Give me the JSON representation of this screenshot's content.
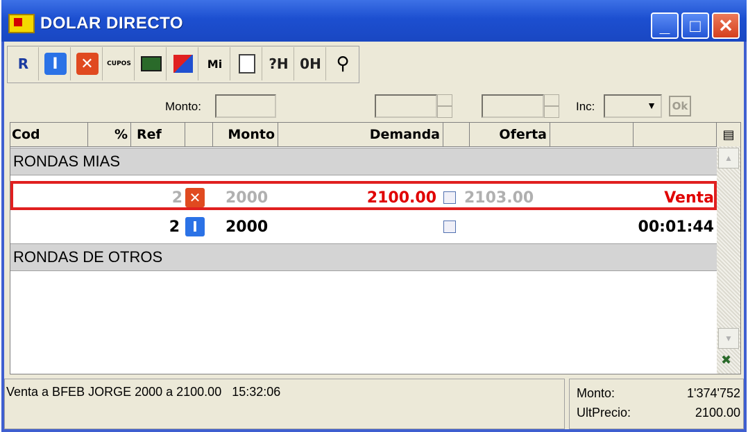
{
  "window": {
    "title": "DOLAR DIRECTO",
    "minimize": "_",
    "maximize": "□",
    "close": "✕"
  },
  "toolbar": {
    "buttons": [
      {
        "label": "R",
        "icon": "new-round-icon"
      },
      {
        "label": "I",
        "icon": "info-icon"
      },
      {
        "label": "✕",
        "icon": "delete-icon"
      },
      {
        "label": "CUPOS",
        "icon": "cupos-icon"
      },
      {
        "label": "",
        "icon": "windows-icon"
      },
      {
        "label": "",
        "icon": "chart-icon"
      },
      {
        "label": "Mi",
        "icon": "mi-percent-icon"
      },
      {
        "label": "",
        "icon": "notes-icon"
      },
      {
        "label": "?H",
        "icon": "query-h-icon"
      },
      {
        "label": "0H",
        "icon": "zero-h-icon"
      },
      {
        "label": "",
        "icon": "wrench-icon"
      }
    ]
  },
  "params": {
    "monto_label": "Monto:",
    "inc_label": "Inc:",
    "ok_label": "Ok"
  },
  "columns": {
    "cod": "Cod",
    "pct": "%",
    "ref": "Ref",
    "monto": "Monto",
    "demanda": "Demanda",
    "oferta": "Oferta"
  },
  "groups": {
    "mias": "RONDAS MIAS",
    "otros": "RONDAS DE OTROS"
  },
  "rows": [
    {
      "ref": "2",
      "monto": "2000",
      "demanda": "2100.00",
      "oferta": "2103.00",
      "status": "Venta",
      "icon": "cancel-icon"
    },
    {
      "ref": "2",
      "monto": "2000",
      "demanda": "",
      "oferta": "",
      "status": "00:01:44",
      "icon": "info-icon"
    }
  ],
  "status": {
    "message": "Venta a BFEB JORGE 2000 a 2100.00   15:32:06",
    "monto_label": "Monto:",
    "monto_value": "1'374'752",
    "ultprecio_label": "UltPrecio:",
    "ultprecio_value": "2100.00"
  },
  "colors": {
    "title_blue": "#1c4fd0",
    "highlight_red": "#e02020",
    "venta_red": "#e00000",
    "info_blue": "#2b72e6",
    "cancel_red": "#e04a20"
  }
}
